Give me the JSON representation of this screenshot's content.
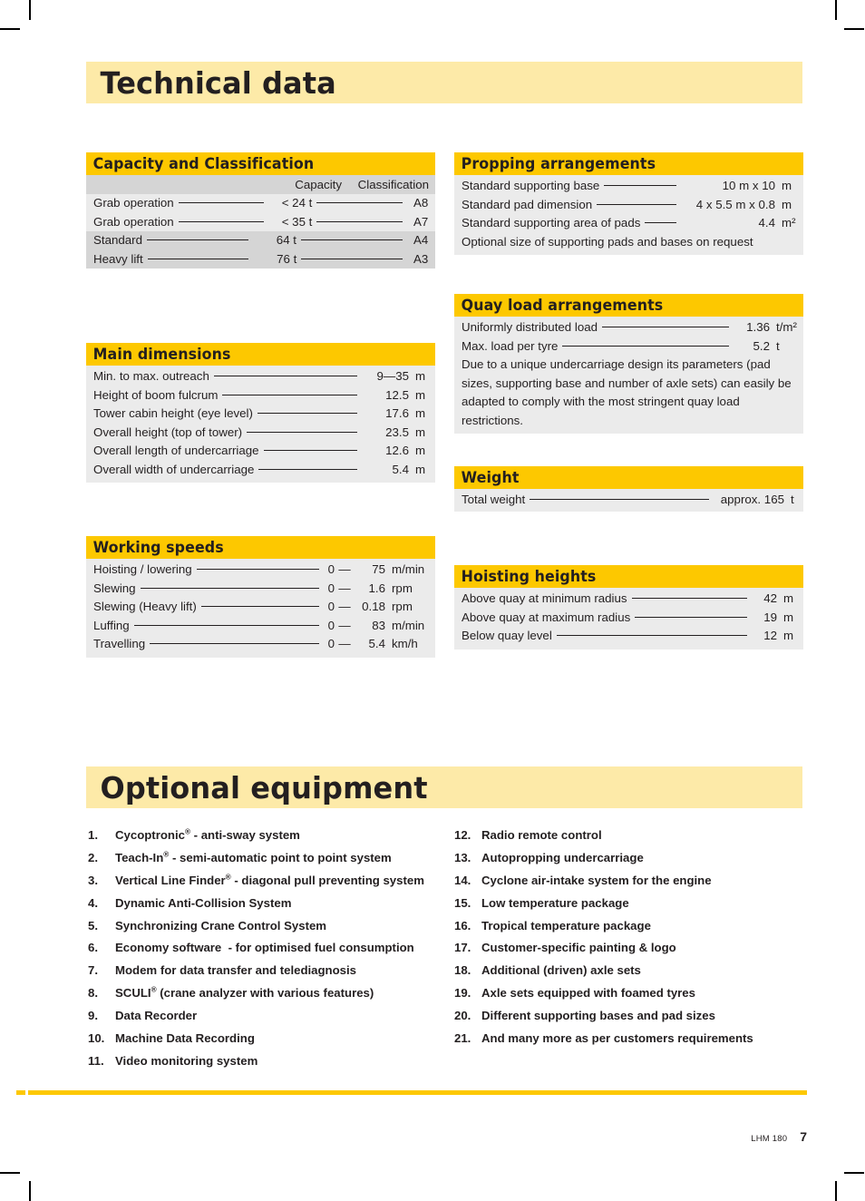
{
  "page": {
    "title": "Technical data",
    "optional_title": "Optional equipment",
    "footer_model": "LHM 180",
    "footer_page": "7",
    "accent_yellow": "#FDC800",
    "banner_yellow": "#FDEAA8",
    "body_gray": "#EBEBEB",
    "band_gray": "#D5D5D5"
  },
  "capacity": {
    "heading": "Capacity and Classification",
    "col_capacity": "Capacity",
    "col_classification": "Classification",
    "rows": [
      {
        "label": "Grab operation",
        "capacity": "< 24 t",
        "classification": "A8"
      },
      {
        "label": "Grab operation",
        "capacity": "< 35 t",
        "classification": "A7"
      },
      {
        "label": "Standard",
        "capacity": "64 t",
        "classification": "A4"
      },
      {
        "label": "Heavy lift",
        "capacity": "76 t",
        "classification": "A3"
      }
    ]
  },
  "main_dimensions": {
    "heading": "Main dimensions",
    "rows": [
      {
        "label": "Min. to max. outreach",
        "value": "9—35",
        "unit": "m"
      },
      {
        "label": "Height of boom fulcrum",
        "value": "12.5",
        "unit": "m"
      },
      {
        "label": "Tower cabin height (eye level)",
        "value": "17.6",
        "unit": "m"
      },
      {
        "label": "Overall height (top of tower)",
        "value": "23.5",
        "unit": "m"
      },
      {
        "label": "Overall length of undercarriage",
        "value": "12.6",
        "unit": "m"
      },
      {
        "label": "Overall width of undercarriage",
        "value": "5.4",
        "unit": "m"
      }
    ]
  },
  "working_speeds": {
    "heading": "Working speeds",
    "rows": [
      {
        "label": "Hoisting / lowering",
        "zero": "0",
        "dash": "—",
        "value": "75",
        "unit": "m/min"
      },
      {
        "label": "Slewing",
        "zero": "0",
        "dash": "—",
        "value": "1.6",
        "unit": "rpm"
      },
      {
        "label": "Slewing (Heavy lift)",
        "zero": "0",
        "dash": "—",
        "value": "0.18",
        "unit": "rpm"
      },
      {
        "label": "Luffing",
        "zero": "0",
        "dash": "—",
        "value": "83",
        "unit": "m/min"
      },
      {
        "label": "Travelling",
        "zero": "0",
        "dash": "—",
        "value": "5.4",
        "unit": "km/h"
      }
    ]
  },
  "propping": {
    "heading": "Propping arrangements",
    "rows": [
      {
        "label": "Standard supporting base",
        "value": "10 m x 10",
        "unit": "m"
      },
      {
        "label": "Standard pad dimension",
        "value": "4 x 5.5 m x 0.8",
        "unit": "m"
      },
      {
        "label": "Standard supporting area of pads",
        "value": "4.4",
        "unit": "m²"
      }
    ],
    "note": "Optional size of supporting pads and bases on request"
  },
  "quay_load": {
    "heading": "Quay load arrangements",
    "rows": [
      {
        "label": "Uniformly distributed load",
        "value": "1.36",
        "unit": "t/m²"
      },
      {
        "label": "Max. load per tyre",
        "value": "5.2",
        "unit": "t"
      }
    ],
    "note": "Due to a unique undercarriage design its parameters (pad sizes, supporting base and number of axle sets) can easily be adapted to comply with the most stringent quay load restrictions."
  },
  "weight": {
    "heading": "Weight",
    "rows": [
      {
        "label": "Total weight",
        "value": "approx. 165",
        "unit": "t"
      }
    ]
  },
  "hoisting_heights": {
    "heading": "Hoisting heights",
    "rows": [
      {
        "label": "Above quay at minimum radius",
        "value": "42",
        "unit": "m"
      },
      {
        "label": "Above quay at maximum radius",
        "value": "19",
        "unit": "m"
      },
      {
        "label": "Below quay level",
        "value": "12",
        "unit": "m"
      }
    ]
  },
  "optional_equipment": {
    "left": [
      {
        "num": "1.",
        "text": "Cycoptronic<sup>®</sup> - anti-sway system"
      },
      {
        "num": "2.",
        "text": "Teach-In<sup>®</sup> - semi-automatic point to point system"
      },
      {
        "num": "3.",
        "text": "Vertical Line Finder<sup>®</sup> - diagonal pull preventing system"
      },
      {
        "num": "4.",
        "text": "Dynamic Anti-Collision System"
      },
      {
        "num": "5.",
        "text": "Synchronizing Crane Control System"
      },
      {
        "num": "6.",
        "text": "Economy software&nbsp; - for optimised fuel consumption"
      },
      {
        "num": "7.",
        "text": "Modem for data transfer and telediagnosis"
      },
      {
        "num": "8.",
        "text": "SCULI<sup>®</sup> (crane analyzer with various features)"
      },
      {
        "num": "9.",
        "text": "Data Recorder"
      },
      {
        "num": "10.",
        "text": "Machine Data Recording"
      },
      {
        "num": "11.",
        "text": "Video monitoring system"
      }
    ],
    "right": [
      {
        "num": "12.",
        "text": "Radio remote control"
      },
      {
        "num": "13.",
        "text": "Autopropping undercarriage"
      },
      {
        "num": "14.",
        "text": "Cyclone air-intake system for the engine"
      },
      {
        "num": "15.",
        "text": "Low temperature package"
      },
      {
        "num": "16.",
        "text": "Tropical temperature package"
      },
      {
        "num": "17.",
        "text": "Customer-specific painting & logo"
      },
      {
        "num": "18.",
        "text": "Additional (driven) axle sets"
      },
      {
        "num": "19.",
        "text": "Axle sets equipped with foamed tyres"
      },
      {
        "num": "20.",
        "text": "Different supporting bases and pad sizes"
      },
      {
        "num": "21.",
        "text": "And many more as per customers requirements"
      }
    ]
  }
}
